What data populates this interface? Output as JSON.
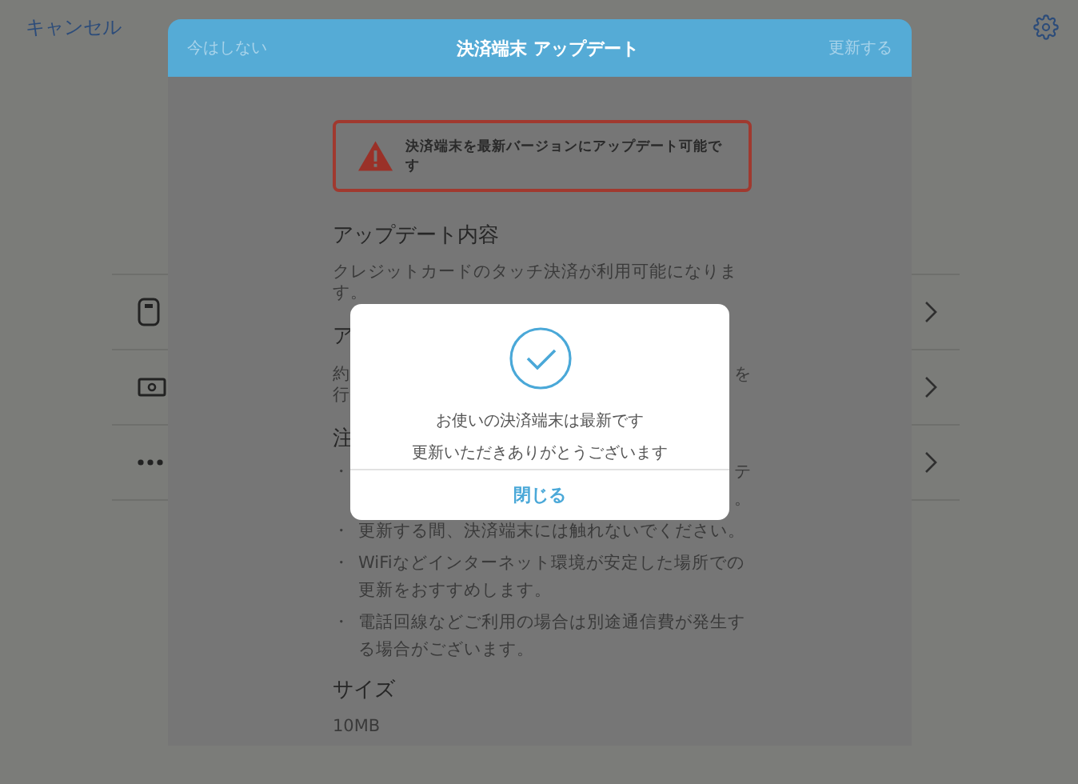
{
  "background": {
    "cancel": "キャンセル",
    "rows": [
      {
        "kind": "device"
      },
      {
        "kind": "cash"
      },
      {
        "kind": "more"
      }
    ]
  },
  "sheet": {
    "left_action": {
      "label": "今はしない",
      "disabled": true
    },
    "title": "決済端末 アップデート",
    "right_action": {
      "label": "更新する",
      "disabled": true
    },
    "alert": "決済端末を最新バージョンにアップデート可能です",
    "sections": [
      {
        "kind": "text",
        "heading": "アップデート内容",
        "body": "クレジットカードのタッチ決済が利用可能になります。"
      },
      {
        "kind": "covered",
        "heading": "ア",
        "lines": [
          {
            "left": "約",
            "right": "を"
          },
          {
            "left": "行"
          }
        ]
      },
      {
        "kind": "list",
        "heading": "注",
        "items": [
          {
            "kind": "covered",
            "bullet": "・",
            "fragments": [
              "テ",
              "。"
            ]
          },
          {
            "kind": "text",
            "bullet": "・",
            "text": "更新する間、決済端末には触れないでください。"
          },
          {
            "kind": "text",
            "bullet": "・",
            "text": "WiFiなどインターネット環境が安定した場所での更新をおすすめします。"
          },
          {
            "kind": "text",
            "bullet": "・",
            "text": "電話回線などご利用の場合は別途通信費が発生する場合がございます。"
          }
        ]
      },
      {
        "kind": "text",
        "heading": "サイズ",
        "body": "10MB"
      }
    ]
  },
  "dialog": {
    "message": "お使いの決済端末は最新です",
    "thanks": "更新いただきありがとうございます",
    "button": "閉じる"
  }
}
